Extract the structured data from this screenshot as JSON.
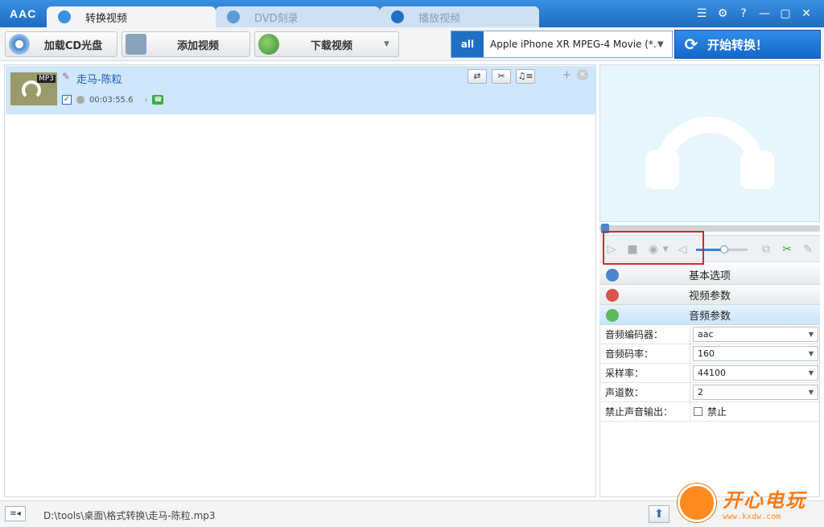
{
  "app": {
    "logo": "AAC"
  },
  "tabs": [
    {
      "label": "转换视频",
      "active": true
    },
    {
      "label": "DVD刻录",
      "active": false
    },
    {
      "label": "播放视频",
      "active": false
    }
  ],
  "window_controls": {
    "menu_icon": "list-icon",
    "settings_icon": "gear-icon",
    "help": "?",
    "minimize": "—",
    "maximize": "▢",
    "close": "✕"
  },
  "toolbar": {
    "load_cd": "加载CD光盘",
    "add_video": "添加视频",
    "download_video": "下载视频"
  },
  "profile": {
    "icon_text": "all",
    "value": "Apple iPhone XR MPEG-4 Movie (*.m..."
  },
  "start_button": {
    "label": "开始转换！"
  },
  "file_list": [
    {
      "name": "走马-陈粒",
      "format_badge": "MP3",
      "checked": true,
      "duration": "00:03:55.6"
    }
  ],
  "row_buttons": {
    "convert": "⇄",
    "cut": "✂",
    "audio": "♫≡",
    "add": "+",
    "remove": "×"
  },
  "player": {
    "volume_level": 0.55
  },
  "sections": [
    {
      "label": "基本选项",
      "selected": false,
      "color": "#4a86c9"
    },
    {
      "label": "视频参数",
      "selected": false,
      "color": "#d9534f"
    },
    {
      "label": "音频参数",
      "selected": true,
      "color": "#5cb85c"
    }
  ],
  "audio_params": [
    {
      "label": "音频编码器：",
      "value": "aac",
      "type": "select"
    },
    {
      "label": "音频码率：",
      "value": "160",
      "type": "select"
    },
    {
      "label": "采样率：",
      "value": "44100",
      "type": "select"
    },
    {
      "label": "声道数：",
      "value": "2",
      "type": "select"
    },
    {
      "label": "禁止声音输出：",
      "value": "禁止",
      "type": "checkbox"
    }
  ],
  "status": {
    "path": "D:\\tools\\桌面\\格式转换\\走马-陈粒.mp3"
  },
  "watermark": {
    "text": "开心电玩",
    "url": "www.kxdw.com"
  },
  "colors": {
    "title_bar": "#1d6dc2",
    "accent": "#1f6fc5",
    "row_selected": "#cfe6fb",
    "highlight_box": "#e0202a"
  }
}
